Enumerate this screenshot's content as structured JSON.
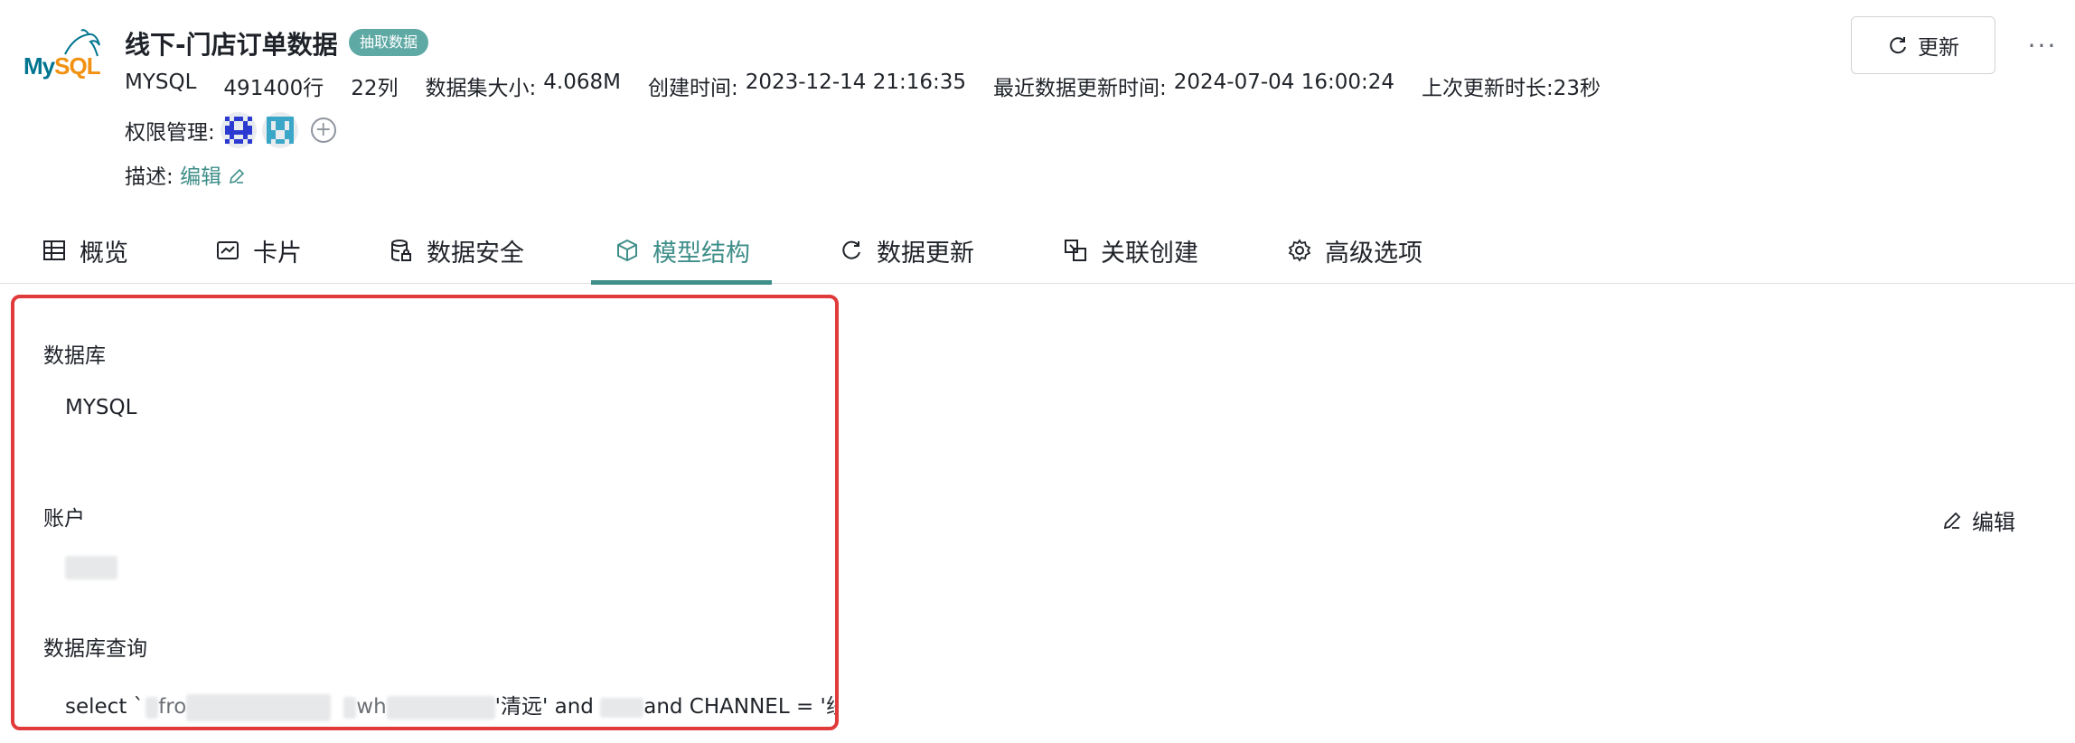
{
  "header": {
    "logo_text_my": "My",
    "logo_text_sql": "SQL",
    "title": "线下-门店订单数据",
    "badge": "抽取数据",
    "meta": {
      "db_type": "MYSQL",
      "rows": "491400行",
      "columns": "22列",
      "size_label": "数据集大小:",
      "size_value": "4.068M",
      "created_label": "创建时间:",
      "created_value": "2023-12-14 21:16:35",
      "updated_label": "最近数据更新时间:",
      "updated_value": "2024-07-04 16:00:24",
      "duration": "上次更新时长:23秒"
    },
    "permission_label": "权限管理:",
    "description_label": "描述:",
    "description_edit": "编辑",
    "refresh_label": "更新",
    "more_label": "···"
  },
  "tabs": [
    {
      "label": "概览",
      "icon": "table-icon"
    },
    {
      "label": "卡片",
      "icon": "chart-card-icon"
    },
    {
      "label": "数据安全",
      "icon": "database-lock-icon"
    },
    {
      "label": "模型结构",
      "icon": "cube-icon",
      "active": true
    },
    {
      "label": "数据更新",
      "icon": "refresh-icon"
    },
    {
      "label": "关联创建",
      "icon": "link-create-icon"
    },
    {
      "label": "高级选项",
      "icon": "gear-icon"
    }
  ],
  "panel": {
    "database_label": "数据库",
    "database_value": "MYSQL",
    "account_label": "账户",
    "query_label": "数据库查询",
    "query_part1": "select `",
    "query_part2": "fro",
    "query_part3": "wh",
    "query_part4": "'清远' and ",
    "query_part5": "and CHANNEL = '线下'"
  },
  "edit_label": "编辑",
  "colors": {
    "accent": "#3e8e89",
    "highlight_border": "#e03a3a",
    "badge_bg": "#5fa9a5"
  }
}
